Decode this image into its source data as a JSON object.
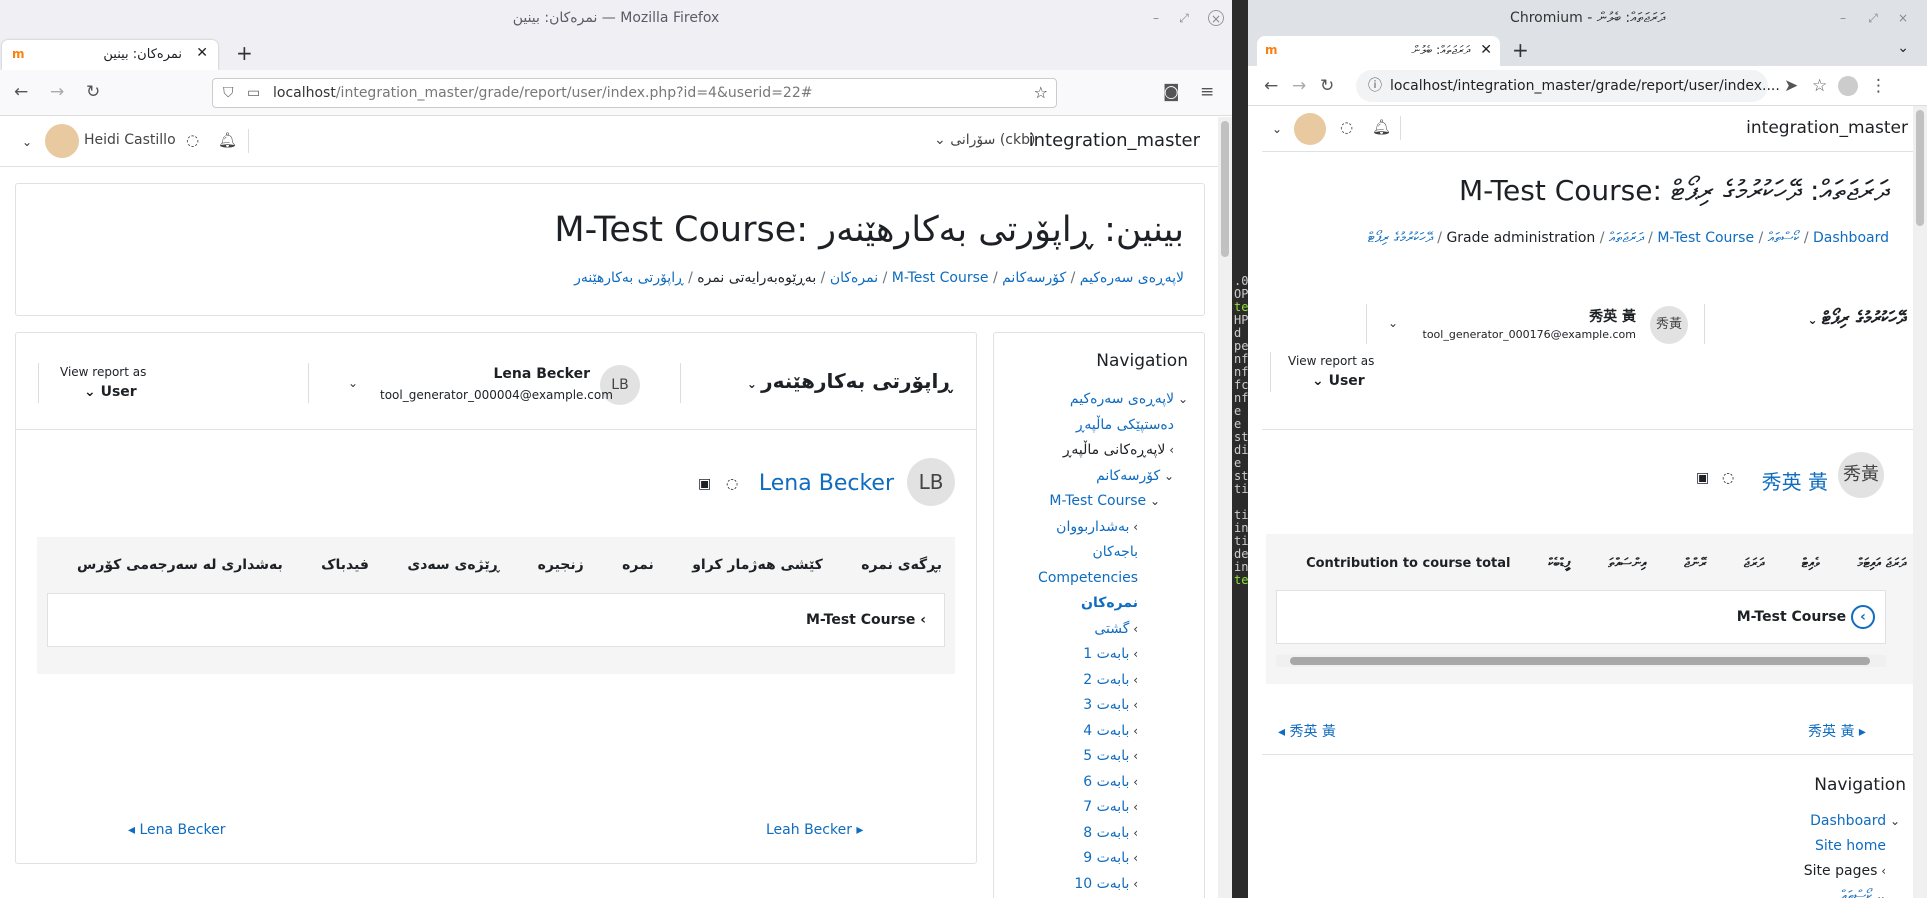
{
  "firefox": {
    "window_title": "نمرەکان: بینین — Mozilla Firefox",
    "tab_title": "نمرەکان: بینین",
    "url_host": "localhost",
    "url_path": "/integration_master/grade/report/user/index.php?id=4&userid=22#",
    "site_name": "integration_master",
    "language": "سۆرانی (ckb)",
    "user_name": "Heidi Castillo",
    "page_heading": "M-Test Course: بینین: ڕاپۆرتی بەکارهێنەر",
    "breadcrumbs": [
      "لاپەڕەی سەرەکیم",
      "کۆرسەکانم",
      "M-Test Course",
      "نمرەکان",
      "بەڕێوەبەرایەتی نمرە",
      "ڕاپۆرتی بەکارهێنەر"
    ],
    "report_selector": "ڕاپۆرتی بەکارهێنەر",
    "selected_user_name": "Lena Becker",
    "selected_user_email": "tool_generator_000004@example.com",
    "selected_user_initials": "LB",
    "view_report_as_label": "View report as",
    "view_report_as_value": "User",
    "report_user_name": "Lena Becker",
    "report_user_initials": "LB",
    "table_headers": [
      "بڕگەی نمرە",
      "کێشی هەژمار کراو",
      "نمرە",
      "زنجیرە",
      "ڕێژەی سەدی",
      "فیدباک",
      "بەشداری لە سەرجەمی کۆرس"
    ],
    "course_row": "M-Test Course",
    "prev_user": "Lena Becker",
    "next_user": "Leah Becker",
    "navigation_title": "Navigation",
    "nav_items": [
      {
        "label": "لاپەڕەی سەرەکیم",
        "type": "link",
        "chev": "down"
      },
      {
        "label": "دەستپێکی ماڵپەڕ",
        "type": "link",
        "chev": ""
      },
      {
        "label": "لاپەڕەکانی ماڵپەڕ",
        "type": "text",
        "chev": "left"
      },
      {
        "label": "کۆرسەکانم",
        "type": "link",
        "chev": "down"
      },
      {
        "label": "M-Test Course",
        "type": "link",
        "chev": "down"
      },
      {
        "label": "بەشداربووان",
        "type": "link",
        "chev": "left"
      },
      {
        "label": "باجەکان",
        "type": "link",
        "chev": ""
      },
      {
        "label": "Competencies",
        "type": "link",
        "chev": ""
      },
      {
        "label": "نمرەکان",
        "type": "bold",
        "chev": ""
      },
      {
        "label": "گشتی",
        "type": "link",
        "chev": "left"
      },
      {
        "label": "بابەت 1",
        "type": "link",
        "chev": "left"
      },
      {
        "label": "بابەت 2",
        "type": "link",
        "chev": "left"
      },
      {
        "label": "بابەت 3",
        "type": "link",
        "chev": "left"
      },
      {
        "label": "بابەت 4",
        "type": "link",
        "chev": "left"
      },
      {
        "label": "بابەت 5",
        "type": "link",
        "chev": "left"
      },
      {
        "label": "بابەت 6",
        "type": "link",
        "chev": "left"
      },
      {
        "label": "بابەت 7",
        "type": "link",
        "chev": "left"
      },
      {
        "label": "بابەت 8",
        "type": "link",
        "chev": "left"
      },
      {
        "label": "بابەت 9",
        "type": "link",
        "chev": "left"
      },
      {
        "label": "بابەت 10",
        "type": "link",
        "chev": "left"
      }
    ]
  },
  "chromium": {
    "window_title": "Chromium - ދަރަޖަތައް: ބެލުން",
    "tab_title": "ދަރަޖަތައް: ބެލުން",
    "url": "localhost/integration_master/grade/report/user/index....",
    "site_name": "integration_master",
    "page_heading": "M-Test Course: ދަރަޖަތައް: ދޭހަކުރުމުގެ ރިޕޯޓް",
    "breadcrumbs": [
      "Dashboard",
      "ކޯސްތައް",
      "M-Test Course",
      "ދަރަޖަތައް",
      "Grade administration",
      "ދޭހަކުރުމުގެ ރިޕޯޓް"
    ],
    "report_selector": "ދޭހަކުރުމުގެ ރިޕޯޓް",
    "selected_user_name": "秀英 黃",
    "selected_user_email": "tool_generator_000176@example.com",
    "selected_user_initials": "秀黃",
    "view_report_as_label": "View report as",
    "view_report_as_value": "User",
    "report_user_name": "秀英 黃",
    "report_user_initials": "秀黃",
    "table_headers": [
      "ދަރަޖަ އައިޓަމް",
      "ވެއިޓް",
      "ދަރަޖަ",
      "ރޭންޖް",
      "އިންސައްތަ",
      "ފީޑްބެކް",
      "Contribution to course total"
    ],
    "course_row": "M-Test Course",
    "prev_user": "秀英 黃",
    "next_user": "秀英 黃",
    "navigation_title": "Navigation",
    "nav_items": [
      {
        "label": "Dashboard",
        "type": "link",
        "chev": "down"
      },
      {
        "label": "Site home",
        "type": "link",
        "chev": ""
      },
      {
        "label": "Site pages",
        "type": "text",
        "chev": "left"
      },
      {
        "label": "ކޯސްތައް",
        "type": "link",
        "chev": "down"
      }
    ]
  },
  "terminal_lines": [
    ".0",
    "OP",
    "te",
    "HP",
    "d",
    "pe",
    "nf",
    "nf",
    "fc",
    "nf",
    "e",
    "e",
    "st",
    "di",
    "e",
    "st",
    "ti",
    "",
    "ti",
    "in",
    "ti",
    "de",
    "in",
    "te"
  ],
  "colors": {
    "link": "#0f6cbf",
    "text": "#1d2125",
    "border": "#dee2e6"
  }
}
